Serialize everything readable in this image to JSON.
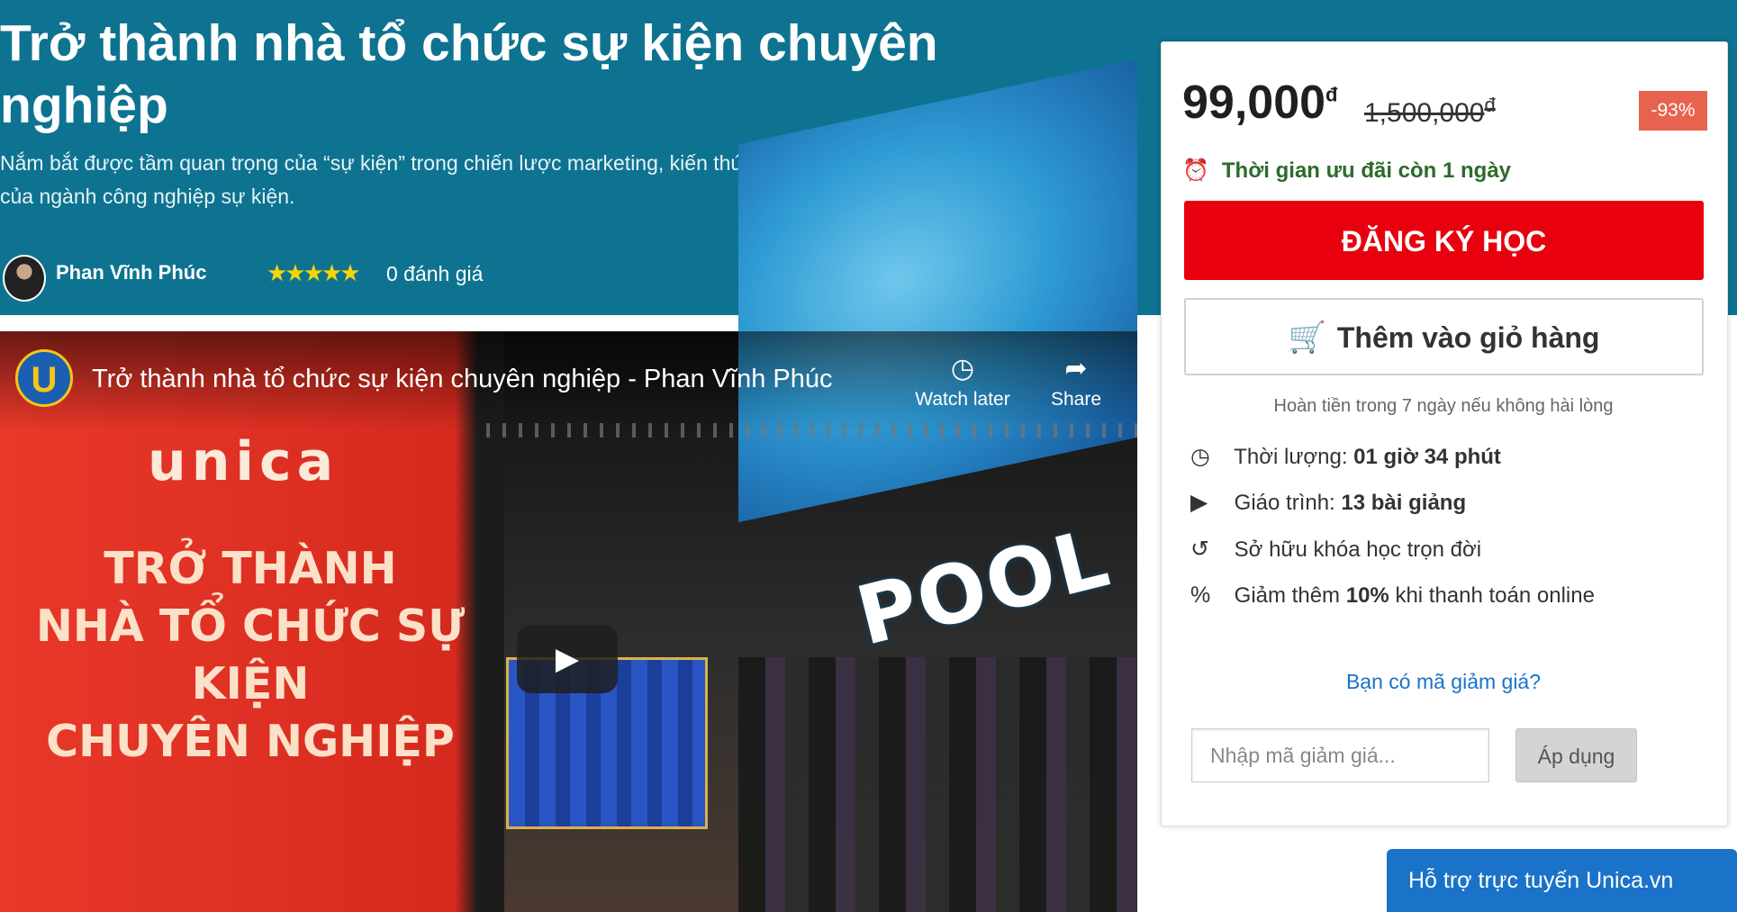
{
  "course": {
    "title": "Trở thành nhà tổ chức sự kiện chuyên nghiệp",
    "description": "Nắm bắt được tầm quan trọng của “sự kiện” trong chiến lược marketing, kiến thức tổng quát và thực tế về sự phát triển của ngành công nghiệp sự kiện.",
    "author": "Phan Vĩnh Phúc",
    "stars": "★★★★★",
    "rating_count": "0 đánh giá"
  },
  "video": {
    "title": "Trở thành nhà tổ chức sự kiện chuyên nghiệp - Phan Vĩnh Phúc",
    "channel_initial": "U",
    "watch_later": "Watch later",
    "share": "Share",
    "brand": "unica",
    "promo_lines": [
      "TRỞ THÀNH",
      "NHÀ TỔ CHỨC SỰ KIỆN",
      "CHUYÊN NGHIỆP"
    ],
    "stage_text": "POOL"
  },
  "pricing": {
    "price": "99,000",
    "currency": "đ",
    "old_price": "1,500,000",
    "discount": "-93%",
    "offer": "Thời gian ưu đãi còn 1 ngày",
    "enroll_label": "ĐĂNG KÝ HỌC",
    "cart_label": "Thêm vào giỏ hàng",
    "refund": "Hoàn tiền trong 7 ngày nếu không hài lòng"
  },
  "features": [
    {
      "icon": "clock-icon",
      "label": "Thời lượng:",
      "value": "01 giờ 34 phút"
    },
    {
      "icon": "play-circle-icon",
      "label": "Giáo trình:",
      "value": "13 bài giảng"
    },
    {
      "icon": "history-icon",
      "label": "Sở hữu khóa học trọn đời",
      "value": ""
    },
    {
      "icon": "percent-icon",
      "label": "Giảm thêm",
      "value": "10%",
      "suffix": "khi thanh toán online"
    }
  ],
  "coupon": {
    "link": "Bạn có mã giảm giá?",
    "placeholder": "Nhập mã giảm giá...",
    "apply": "Áp dụng"
  },
  "support": {
    "label": "Hỗ trợ trực tuyến Unica.vn"
  }
}
